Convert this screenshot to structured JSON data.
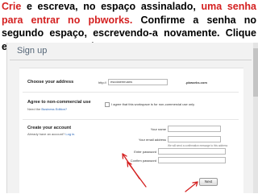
{
  "caption": {
    "part1_red": "Crie",
    "part2": " e escreva, no espaço assinalado, ",
    "part3_red": "uma senha para entrar no pbworks.",
    "part4": "  Confirme a senha no segundo espaço, escrevendo-a novamente.  Clique em Next para seguir."
  },
  "form": {
    "title": "Sign up",
    "address": {
      "heading": "Choose your address",
      "prefix": "http://",
      "value": "escolaemruans",
      "suffix": ".pbworks.com"
    },
    "agreement": {
      "heading": "Agree to non-commercial use",
      "sub_text": "Need the ",
      "sub_link": "Business Edition?",
      "checkbox_label": "I agree that this workspace is for non-commercial use only"
    },
    "account": {
      "heading": "Create your account",
      "sub_text": "Already have an account? ",
      "sub_link": "Log in.",
      "name_label": "Your name",
      "email_label": "Your email address",
      "email_hint": "We will send a confirmation message to this address",
      "password_label": "Enter password",
      "confirm_label": "Confirm password"
    },
    "next_label": "Next"
  },
  "colors": {
    "highlight_red": "#d42020",
    "link_blue": "#2a66b8"
  }
}
